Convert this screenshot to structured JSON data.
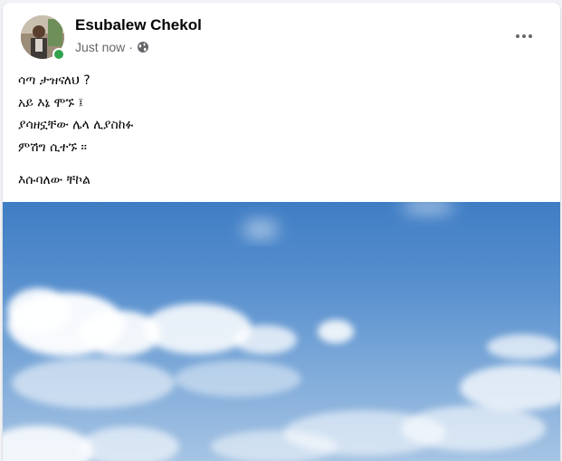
{
  "post": {
    "author_name": "Esubalew Chekol",
    "timestamp": "Just now",
    "separator": "·",
    "privacy_icon": "globe-icon",
    "more_icon": "more-horizontal-icon",
    "text_lines": [
      "ሳጣ ታዝናለህ ?",
      "አይ እኔ ሞኙ ፤",
      "ያሳዘኗቸው ሌላ ሊያስከፉ",
      "ምሽግ ሲተኙ ።"
    ],
    "signature": "እሱባለው ቸኮል"
  },
  "colors": {
    "online_status": "#31a24c",
    "author_text": "#050505",
    "meta_text": "#65676b",
    "sky": "#4a86c8"
  }
}
